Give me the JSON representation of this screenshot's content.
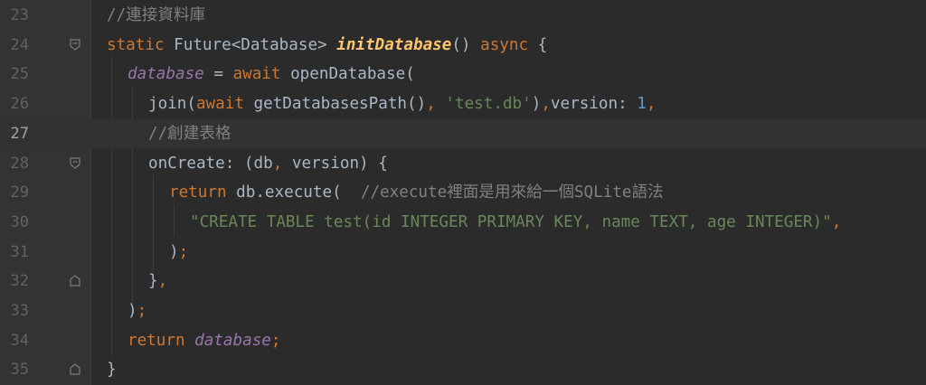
{
  "editor": {
    "lines": [
      {
        "number": "23",
        "tokens": [
          "//連接資料庫"
        ]
      },
      {
        "number": "24",
        "tokens": [
          "static",
          " Future<Database> ",
          "initDatabase",
          "() ",
          "async",
          " {"
        ]
      },
      {
        "number": "25",
        "tokens": [
          "database",
          " = ",
          "await",
          " openDatabase("
        ]
      },
      {
        "number": "26",
        "tokens": [
          "join(",
          "await",
          " getDatabasesPath()",
          ", ",
          "'test.db'",
          ")",
          ",",
          "version: ",
          "1",
          ","
        ]
      },
      {
        "number": "27",
        "tokens": [
          "//創建表格"
        ]
      },
      {
        "number": "28",
        "tokens": [
          "onCreate: (db",
          ", ",
          "version) {"
        ]
      },
      {
        "number": "29",
        "tokens": [
          "return",
          " db.execute(  ",
          "//execute裡面是用來給一個SQLite語法"
        ]
      },
      {
        "number": "30",
        "tokens": [
          "\"CREATE TABLE test(id INTEGER PRIMARY KEY, name TEXT, age INTEGER)\"",
          ","
        ]
      },
      {
        "number": "31",
        "tokens": [
          ")",
          ";"
        ]
      },
      {
        "number": "32",
        "tokens": [
          "}",
          ","
        ]
      },
      {
        "number": "33",
        "tokens": [
          ")",
          ";"
        ]
      },
      {
        "number": "34",
        "tokens": [
          "return ",
          "database",
          ";"
        ]
      },
      {
        "number": "35",
        "tokens": [
          "}"
        ]
      }
    ],
    "current_line": "27",
    "colors": {
      "background": "#2b2b2b",
      "gutter": "#313335",
      "keyword": "#cc7832",
      "function": "#ffc66d",
      "variable": "#9876aa",
      "string": "#6a8759",
      "number": "#6897bb",
      "comment": "#808080",
      "plain": "#a9b7c6"
    }
  }
}
